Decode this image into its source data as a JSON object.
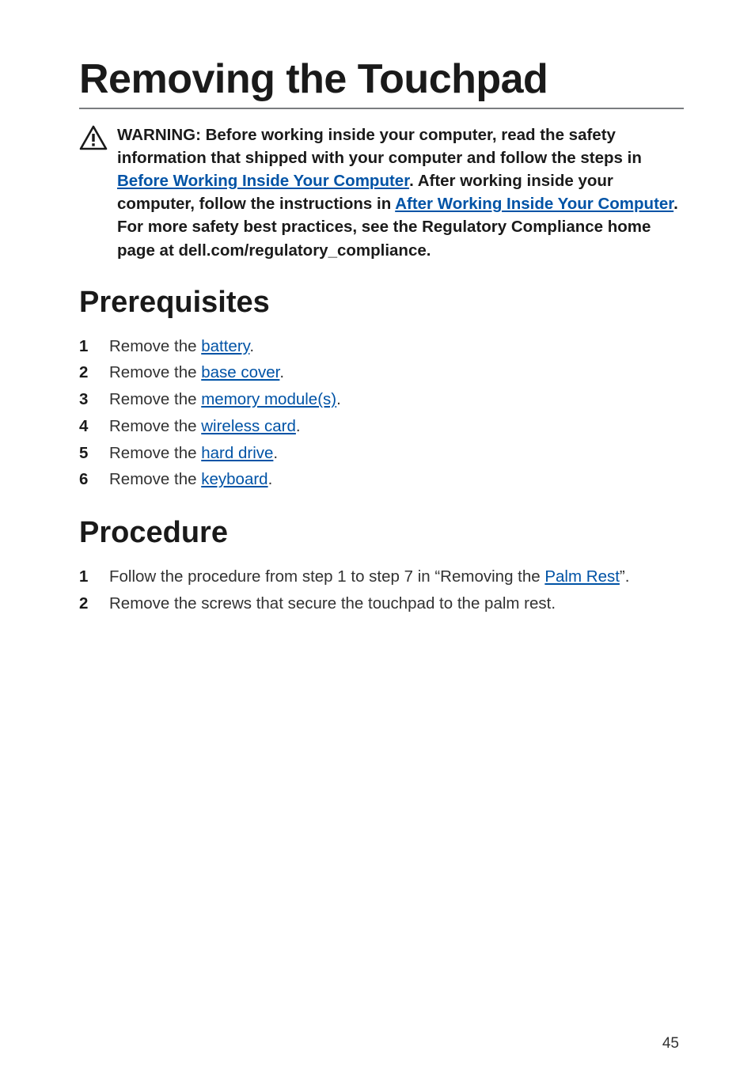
{
  "title": "Removing the Touchpad",
  "warning": {
    "prefix": "WARNING: Before working inside your computer, read the safety information that shipped with your computer and follow the steps in ",
    "link1": "Before Working Inside Your Computer",
    "mid1": ". After working inside your computer, follow the instructions in ",
    "link2": "After Working Inside Your Computer",
    "suffix": ". For more safety best practices, see the Regulatory Compliance home page at dell.com/regulatory_compliance."
  },
  "prereq": {
    "heading": "Prerequisites",
    "items": [
      {
        "n": "1",
        "pre": "Remove the ",
        "link": "battery",
        "post": "."
      },
      {
        "n": "2",
        "pre": "Remove the ",
        "link": "base cover",
        "post": "."
      },
      {
        "n": "3",
        "pre": "Remove the ",
        "link": "memory module(s)",
        "post": "."
      },
      {
        "n": "4",
        "pre": "Remove the ",
        "link": "wireless card",
        "post": "."
      },
      {
        "n": "5",
        "pre": "Remove the ",
        "link": "hard drive",
        "post": "."
      },
      {
        "n": "6",
        "pre": "Remove the ",
        "link": "keyboard",
        "post": "."
      }
    ]
  },
  "procedure": {
    "heading": "Procedure",
    "items": [
      {
        "n": "1",
        "pre": "Follow the procedure from step 1 to step 7 in “Removing the ",
        "link": "Palm Rest",
        "post": "”."
      },
      {
        "n": "2",
        "pre": "Remove the screws that secure the touchpad to the palm rest.",
        "link": "",
        "post": ""
      }
    ]
  },
  "page_number": "45"
}
